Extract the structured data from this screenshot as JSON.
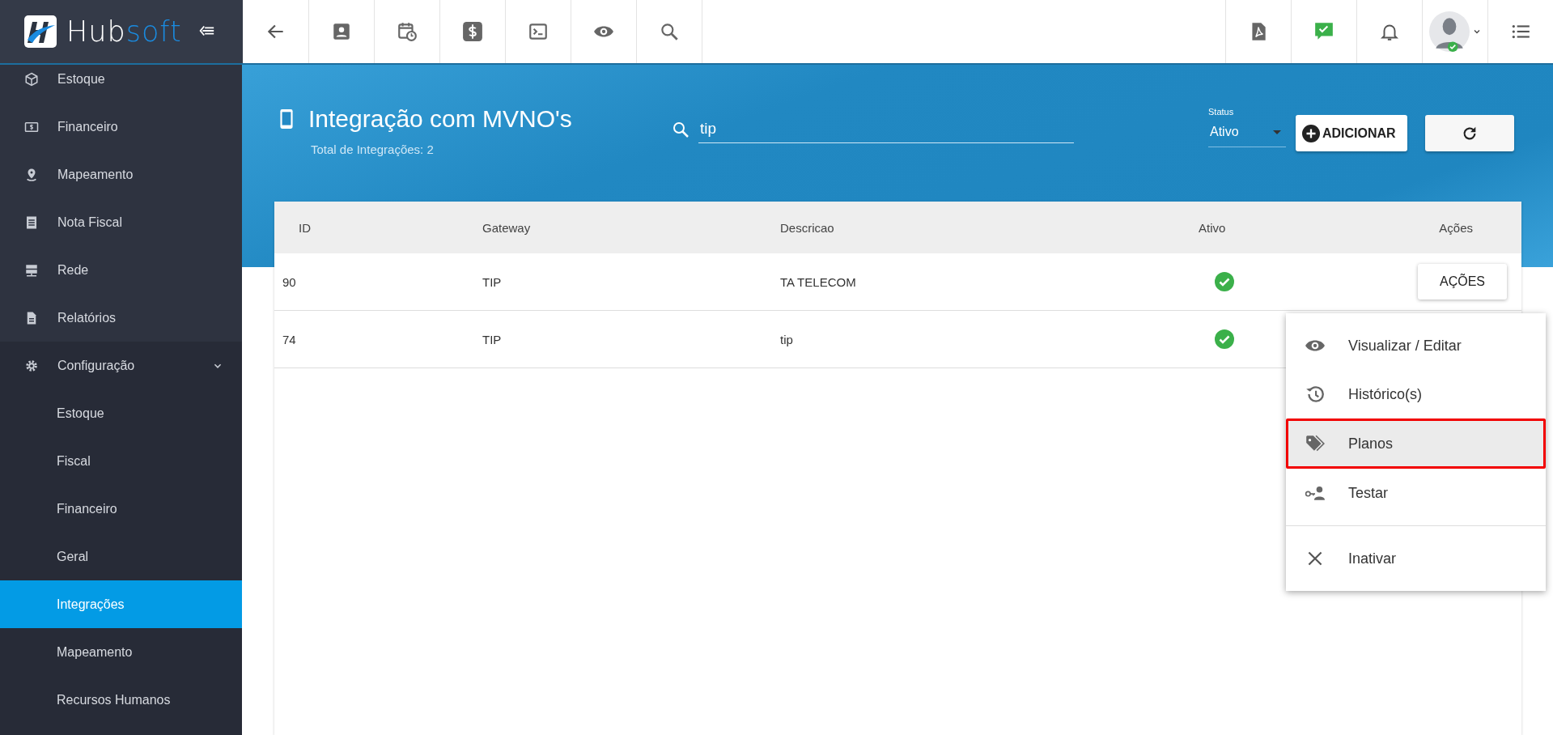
{
  "brand": {
    "name_part_1": "Hub",
    "name_part_2": "soft"
  },
  "sidebar": {
    "items": [
      {
        "label": "Estoque",
        "selected": false
      },
      {
        "label": "Financeiro",
        "selected": false
      },
      {
        "label": "Mapeamento",
        "selected": false
      },
      {
        "label": "Nota Fiscal",
        "selected": false
      },
      {
        "label": "Rede",
        "selected": false
      },
      {
        "label": "Relatórios",
        "selected": false
      },
      {
        "label": "Configuração",
        "selected": false,
        "expanded": true,
        "children": [
          {
            "label": "Estoque",
            "selected": false
          },
          {
            "label": "Fiscal",
            "selected": false
          },
          {
            "label": "Financeiro",
            "selected": false
          },
          {
            "label": "Geral",
            "selected": false
          },
          {
            "label": "Integrações",
            "selected": true
          },
          {
            "label": "Mapeamento",
            "selected": false
          },
          {
            "label": "Recursos Humanos",
            "selected": false
          }
        ]
      }
    ]
  },
  "page": {
    "title": "Integração com MVNO's",
    "subtitle": "Total de Integrações: 2"
  },
  "search": {
    "value": "tip"
  },
  "status_filter": {
    "label": "Status",
    "value": "Ativo"
  },
  "add_button": "ADICIONAR",
  "table": {
    "columns": [
      "ID",
      "Gateway",
      "Descricao",
      "Ativo",
      "Ações"
    ],
    "rows": [
      {
        "id": "90",
        "gateway": "TIP",
        "description": "TA TELECOM",
        "active": true,
        "actions_button": "AÇÕES"
      },
      {
        "id": "74",
        "gateway": "TIP",
        "description": "tip",
        "active": true
      }
    ]
  },
  "actions_menu": {
    "items": [
      {
        "label": "Visualizar / Editar",
        "selected": false
      },
      {
        "label": "Histórico(s)",
        "selected": false
      },
      {
        "label": "Planos",
        "selected": true
      },
      {
        "label": "Testar",
        "selected": false
      },
      {
        "label": "Inativar",
        "selected": false
      }
    ]
  }
}
